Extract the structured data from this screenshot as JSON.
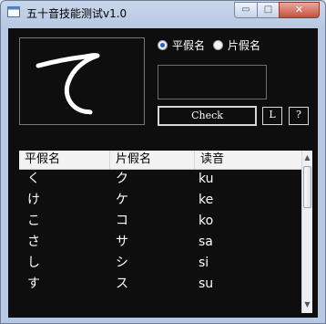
{
  "window": {
    "title": "五十音技能测试v1.0",
    "controls": {
      "minimize": "▭",
      "maximize": "□",
      "close": "✕"
    }
  },
  "drawing": {
    "kana": "て"
  },
  "mode": {
    "options": [
      {
        "label": "平假名",
        "selected": true
      },
      {
        "label": "片假名",
        "selected": false
      }
    ]
  },
  "answer": {
    "value": ""
  },
  "buttons": {
    "check": "Check",
    "l": "L",
    "help": "?"
  },
  "table": {
    "headers": [
      "平假名",
      "片假名",
      "读音"
    ],
    "rows": [
      [
        "く",
        "ク",
        "ku"
      ],
      [
        "け",
        "ケ",
        "ke"
      ],
      [
        "こ",
        "コ",
        "ko"
      ],
      [
        "さ",
        "サ",
        "sa"
      ],
      [
        "し",
        "シ",
        "si"
      ],
      [
        "す",
        "ス",
        "su"
      ]
    ]
  },
  "colors": {
    "background": "#0e0e0e",
    "accent": "#1b66c9",
    "text": "#ffffff"
  }
}
